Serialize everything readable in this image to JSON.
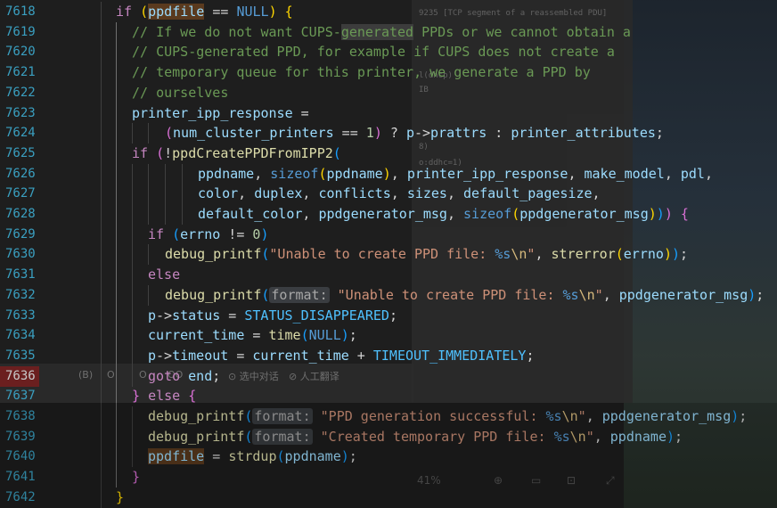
{
  "background": {
    "ghost_window_lines": [
      "9235 [TCP segment of a reassembled PDU]",
      "l(dhcp)",
      "IB",
      "8)",
      "o:ddhc=1)"
    ],
    "ghost_bar_items": [
      "(B)",
      "O",
      "O",
      "OO",
      "⊙ 选中对话",
      "⊘ 人工翻译"
    ],
    "ghost_toolbar_zoom": "41%"
  },
  "editor": {
    "lines": [
      {
        "n": "7618",
        "html": "<span class='kw'>if</span> <span class='br1'>(</span><span class='var hl'>ppdfile</span> == <span class='kw2'>NULL</span><span class='br1'>)</span> <span class='br1'>{</span>"
      },
      {
        "n": "7619",
        "html": "<span class='cmt'>// If we do not want CUPS-<span class='hlc'>generated</span> PPDs or we cannot obtain a</span>"
      },
      {
        "n": "7620",
        "html": "<span class='cmt'>// CUPS-generated PPD, for example if CUPS does not create a</span>"
      },
      {
        "n": "7621",
        "html": "<span class='cmt'>// temporary queue for this printer, we generate a PPD by</span>"
      },
      {
        "n": "7622",
        "html": "<span class='cmt'>// ourselves</span>"
      },
      {
        "n": "7623",
        "html": "<span class='var'>printer_ipp_response</span> ="
      },
      {
        "n": "7624",
        "html": "<span class='br2'>(</span><span class='var'>num_cluster_printers</span> == <span class='num'>1</span><span class='br2'>)</span> ? <span class='var'>p</span>-&gt;<span class='var'>prattrs</span> : <span class='var'>printer_attributes</span>;"
      },
      {
        "n": "7625",
        "html": "<span class='kw'>if</span> <span class='br2'>(</span>!<span class='fn'>ppdCreatePPDFromIPP2</span><span class='br3'>(</span>"
      },
      {
        "n": "7626",
        "html": "<span class='var'>ppdname</span>, <span class='kw2'>sizeof</span><span class='br1'>(</span><span class='var'>ppdname</span><span class='br1'>)</span>, <span class='var'>printer_ipp_response</span>, <span class='var'>make_model</span>, <span class='var'>pdl</span>,"
      },
      {
        "n": "7627",
        "html": "<span class='var'>color</span>, <span class='var'>duplex</span>, <span class='var'>conflicts</span>, <span class='var'>sizes</span>, <span class='var'>default_pagesize</span>,"
      },
      {
        "n": "7628",
        "html": "<span class='var'>default_color</span>, <span class='var'>ppdgenerator_msg</span>, <span class='kw2'>sizeof</span><span class='br1'>(</span><span class='var'>ppdgenerator_msg</span><span class='br1'>)</span><span class='br3'>)</span><span class='br2'>)</span> <span class='br2'>{</span>"
      },
      {
        "n": "7629",
        "html": "<span class='kw'>if</span> <span class='br3'>(</span><span class='var'>errno</span> != <span class='num'>0</span><span class='br3'>)</span>"
      },
      {
        "n": "7630",
        "html": "<span class='fn'>debug_printf</span><span class='br3'>(</span><span class='str'>\"Unable to create PPD file: <span class='kw2'>%s</span><span class='esc'>\\n</span>\"</span>, <span class='fn'>strerror</span><span class='br1'>(</span><span class='var'>errno</span><span class='br1'>)</span><span class='br3'>)</span>;"
      },
      {
        "n": "7631",
        "html": "<span class='kw'>else</span>"
      },
      {
        "n": "7632",
        "html": "<span class='fn'>debug_printf</span><span class='br3'>(</span><span class='hint'>format:</span> <span class='str'>\"Unable to create PPD file: <span class='kw2'>%s</span><span class='esc'>\\n</span>\"</span>, <span class='var'>ppdgenerator_msg</span><span class='br3'>)</span>;"
      },
      {
        "n": "7633",
        "html": "<span class='var'>p</span>-&gt;<span class='var'>status</span> = <span class='mac'>STATUS_DISAPPEARED</span>;"
      },
      {
        "n": "7634",
        "html": "<span class='var'>current_time</span> = <span class='fn'>time</span><span class='br3'>(</span><span class='kw2'>NULL</span><span class='br3'>)</span>;"
      },
      {
        "n": "7635",
        "html": "<span class='var'>p</span>-&gt;<span class='var'>timeout</span> = <span class='var'>current_time</span> + <span class='mac'>TIMEOUT_IMMEDIATELY</span>;"
      },
      {
        "n": "7636",
        "html": "<span class='kw'>goto</span> <span class='var'>end</span>;"
      },
      {
        "n": "7637",
        "html": "<span class='br2'>}</span> <span class='kw'>else</span> <span class='br2'>{</span>"
      },
      {
        "n": "7638",
        "html": "<span class='fn'>debug_printf</span><span class='br3'>(</span><span class='hint'>format:</span> <span class='str'>\"PPD generation successful: <span class='kw2'>%s</span><span class='esc'>\\n</span>\"</span>, <span class='var'>ppdgenerator_msg</span><span class='br3'>)</span>;"
      },
      {
        "n": "7639",
        "html": "<span class='fn'>debug_printf</span><span class='br3'>(</span><span class='hint'>format:</span> <span class='str'>\"Created temporary PPD file: <span class='kw2'>%s</span><span class='esc'>\\n</span>\"</span>, <span class='var'>ppdname</span><span class='br3'>)</span>;"
      },
      {
        "n": "7640",
        "html": "<span class='var hl'>ppdfile</span> = <span class='fn'>strdup</span><span class='br3'>(</span><span class='var'>ppdname</span><span class='br3'>)</span>;"
      },
      {
        "n": "7641",
        "html": "<span class='br2'>}</span>"
      },
      {
        "n": "7642",
        "html": "<span class='br1'>}</span>"
      }
    ]
  }
}
